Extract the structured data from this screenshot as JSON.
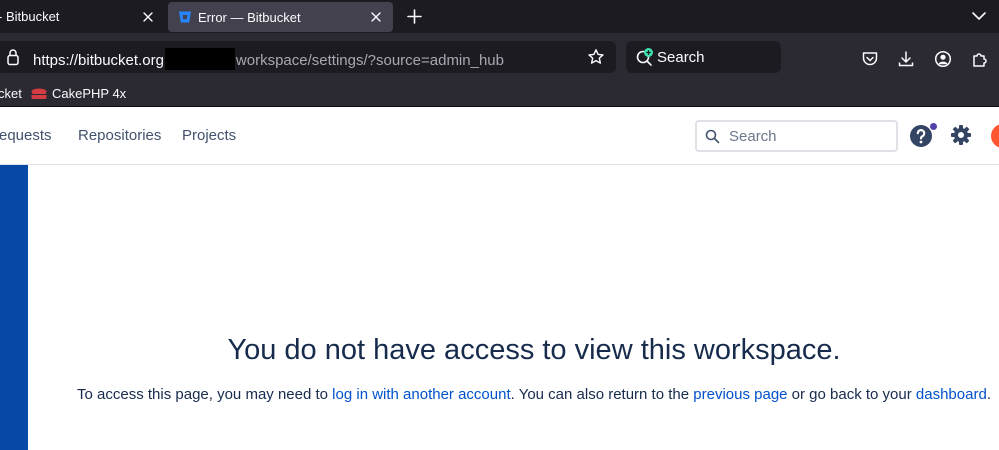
{
  "browser": {
    "tabs": [
      {
        "label": "- Bitbucket"
      },
      {
        "label": "Error — Bitbucket"
      }
    ],
    "url": {
      "host": "https://bitbucket.org",
      "path": "workspace/settings/?source=admin_hub"
    },
    "web_search": {
      "label": "Search"
    },
    "bookmarks": [
      {
        "label": "cket"
      },
      {
        "label": "CakePHP 4x"
      }
    ]
  },
  "app": {
    "nav": {
      "pull_requests": "requests",
      "repositories": "Repositories",
      "projects": "Projects"
    },
    "search": {
      "placeholder": "Search"
    }
  },
  "error": {
    "title": "You do not have access to view this workspace.",
    "line_prefix": "To access this page, you may need to ",
    "login_link": "log in with another account",
    "line_middle": ". You can also return to the ",
    "previous_link": "previous page",
    "line_after_previous": " or go back to your ",
    "dashboard_link": "dashboard",
    "line_suffix": "."
  },
  "colors": {
    "browser_frame": "#1c1b22",
    "toolbar": "#2b2a33",
    "brand_blue": "#0747a6",
    "link": "#0052cc",
    "heading": "#172b4d"
  },
  "icons": {
    "favicon": "bitbucket-icon",
    "lock": "lock-icon",
    "bookmark_star": "star-icon",
    "help": "help-icon",
    "settings": "gear-icon"
  }
}
